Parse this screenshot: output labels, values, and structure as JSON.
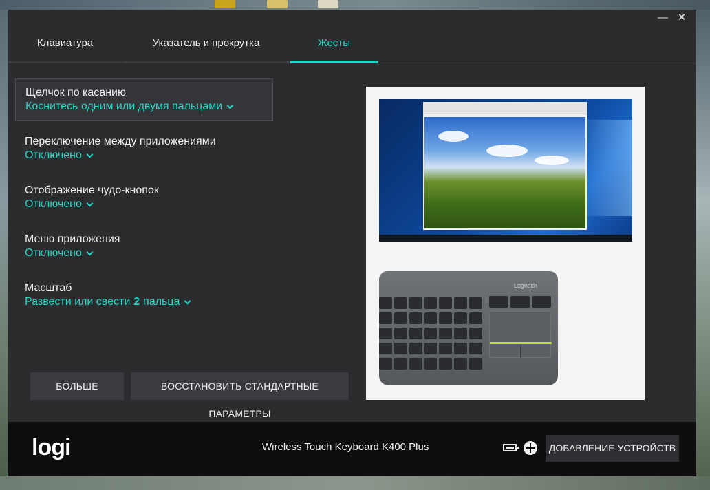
{
  "window": {
    "controls": {
      "minimize": "—",
      "close": "✕"
    }
  },
  "tabs": [
    {
      "label": "Клавиатура",
      "active": false
    },
    {
      "label": "Указатель и прокрутка",
      "active": false
    },
    {
      "label": "Жесты",
      "active": true
    }
  ],
  "gestures": [
    {
      "title": "Щелчок по касанию",
      "value": "Коснитесь одним или двумя пальцами",
      "selected": true
    },
    {
      "title": "Переключение между приложениями",
      "value": "Отключено",
      "selected": false
    },
    {
      "title": "Отображение чудо-кнопок",
      "value": "Отключено",
      "selected": false
    },
    {
      "title": "Меню приложения",
      "value": "Отключено",
      "selected": false
    },
    {
      "title": "Масштаб",
      "value_prefix": "Развести или свести",
      "value_bold": "2",
      "value_suffix": "пальца",
      "selected": false
    }
  ],
  "buttons": {
    "more": "БОЛЬШЕ",
    "restore_defaults": "ВОССТАНОВИТЬ СТАНДАРТНЫЕ ПАРАМЕТРЫ"
  },
  "preview": {
    "keyboard_brand": "Logitech"
  },
  "footer": {
    "logo": "logi",
    "device_name": "Wireless Touch Keyboard K400 Plus",
    "add_devices": "ДОБАВЛЕНИЕ УСТРОЙСТВ",
    "icons": [
      "battery-icon",
      "unifying-receiver-icon"
    ]
  },
  "colors": {
    "accent": "#23d6c6",
    "window_bg": "#2b2c2e",
    "footer_bg": "#0e0e0f"
  }
}
